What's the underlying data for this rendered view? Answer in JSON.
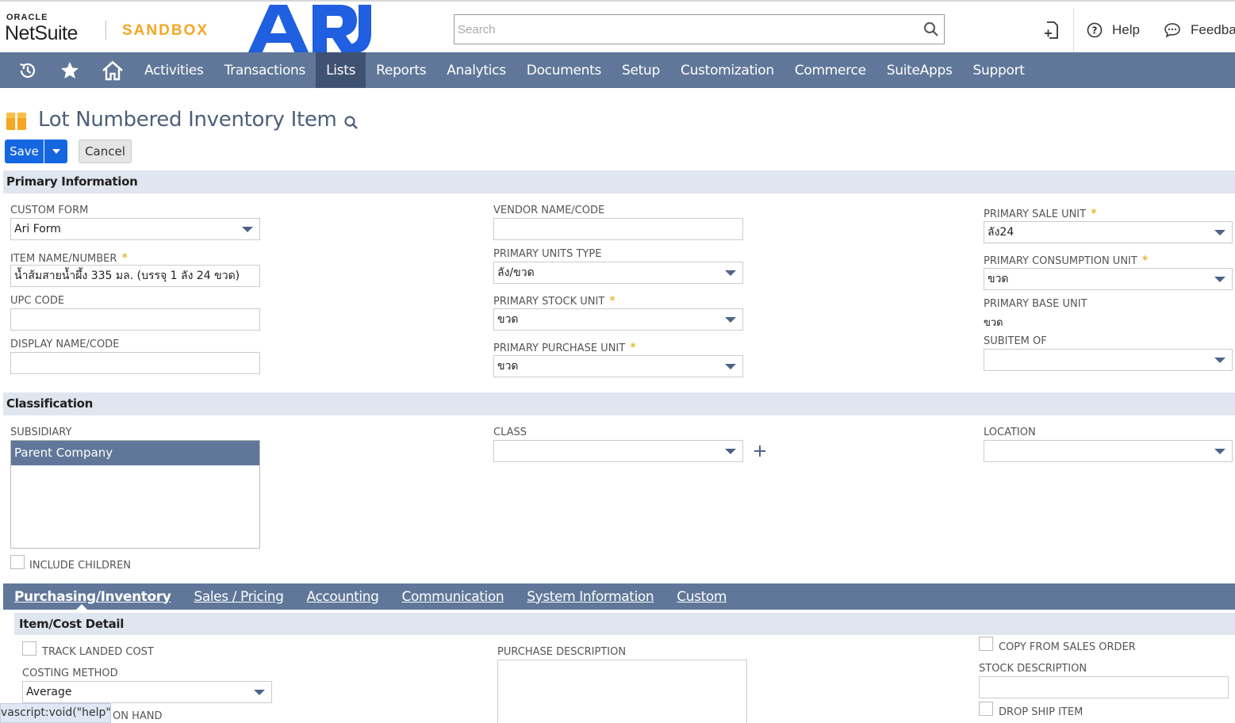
{
  "header": {
    "oracle_text": "ORACLE",
    "brand": "NetSuite",
    "environment": "SANDBOX",
    "company_logo_text": "ARI",
    "search_placeholder": "Search",
    "help_label": "Help",
    "feedback_label": "Feedba"
  },
  "nav": {
    "icons": [
      "recent-records-icon",
      "star-icon",
      "home-icon"
    ],
    "items": [
      {
        "label": "Activities"
      },
      {
        "label": "Transactions"
      },
      {
        "label": "Lists",
        "active": true
      },
      {
        "label": "Reports"
      },
      {
        "label": "Analytics"
      },
      {
        "label": "Documents"
      },
      {
        "label": "Setup"
      },
      {
        "label": "Customization"
      },
      {
        "label": "Commerce"
      },
      {
        "label": "SuiteApps"
      },
      {
        "label": "Support"
      }
    ]
  },
  "page": {
    "title": "Lot Numbered Inventory Item",
    "save_label": "Save",
    "cancel_label": "Cancel"
  },
  "primary": {
    "section_title": "Primary Information",
    "custom_form_label": "CUSTOM FORM",
    "custom_form_value": "Ari Form",
    "item_name_label": "ITEM NAME/NUMBER",
    "item_name_value": "น้ำส้มสายน้ำผึ้ง 335 มล. (บรรจุ 1 ลัง 24 ขวด)",
    "upc_label": "UPC CODE",
    "upc_value": "",
    "display_name_label": "DISPLAY NAME/CODE",
    "display_name_value": "",
    "vendor_name_label": "VENDOR NAME/CODE",
    "vendor_name_value": "",
    "units_type_label": "PRIMARY UNITS TYPE",
    "units_type_value": "ลัง/ขวด",
    "stock_unit_label": "PRIMARY STOCK UNIT",
    "stock_unit_value": "ขวด",
    "purchase_unit_label": "PRIMARY PURCHASE UNIT",
    "purchase_unit_value": "ขวด",
    "sale_unit_label": "PRIMARY SALE UNIT",
    "sale_unit_value": "ลัง24",
    "consumption_unit_label": "PRIMARY CONSUMPTION UNIT",
    "consumption_unit_value": "ขวด",
    "base_unit_label": "PRIMARY BASE UNIT",
    "base_unit_value": "ขวด",
    "subitem_label": "SUBITEM OF",
    "subitem_value": "",
    "required_mark": "*"
  },
  "classification": {
    "section_title": "Classification",
    "subsidiary_label": "SUBSIDIARY",
    "subsidiary_selected": "Parent Company",
    "include_children_label": "INCLUDE CHILDREN",
    "class_label": "CLASS",
    "class_value": "",
    "location_label": "LOCATION",
    "location_value": ""
  },
  "subtabs": {
    "items": [
      {
        "label": "Purchasing/Inventory",
        "active": true
      },
      {
        "label": "Sales / Pricing"
      },
      {
        "label": "Accounting"
      },
      {
        "label": "Communication"
      },
      {
        "label": "System Information"
      },
      {
        "label": "Custom"
      }
    ]
  },
  "cost_detail": {
    "section_title": "Item/Cost Detail",
    "track_landed_cost_label": "TRACK LANDED COST",
    "costing_method_label": "COSTING METHOD",
    "costing_method_value": "Average",
    "on_hand_label": "ON HAND",
    "purchase_description_label": "PURCHASE DESCRIPTION",
    "copy_from_sales_order_label": "COPY FROM SALES ORDER",
    "stock_description_label": "STOCK DESCRIPTION",
    "drop_ship_label": "DROP SHIP ITEM"
  },
  "status_bar": {
    "text": "vascript:void(\"help\")"
  },
  "colors": {
    "nav_bg": "#607799",
    "nav_active": "#3f5271",
    "save_button": "#1467e0",
    "section_bg": "#e0e6ef",
    "sandbox_orange": "#f5a623",
    "logo_blue": "#1f5fe0"
  }
}
